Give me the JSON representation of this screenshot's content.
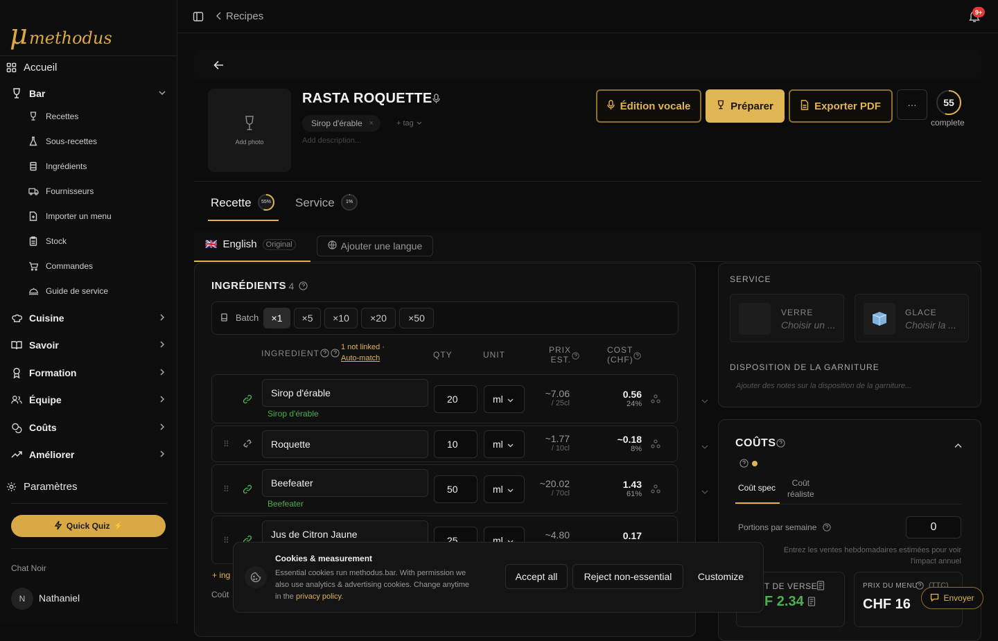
{
  "sidebar": {
    "logo_mu": "μ",
    "logo_name": "methodus",
    "home": "Accueil",
    "bar": "Bar",
    "bar_items": [
      "Recettes",
      "Sous-recettes",
      "Ingrédients",
      "Fournisseurs",
      "Importer un menu",
      "Stock",
      "Commandes",
      "Guide de service"
    ],
    "sections": [
      "Cuisine",
      "Savoir",
      "Formation",
      "Équipe",
      "Coûts",
      "Améliorer"
    ],
    "settings": "Paramètres",
    "quiz": "Quick Quiz",
    "org": "Chat Noir",
    "avatar_initial": "N",
    "user": "Nathaniel"
  },
  "topbar": {
    "breadcrumb": "Recipes",
    "notif_badge": "9+"
  },
  "recipe": {
    "title": "RASTA ROQUETTE",
    "add_photo": "Add photo",
    "tag": "Sirop d'érable",
    "add_tag": "+ tag",
    "description_placeholder": "Add description...",
    "btn_voice": "Édition vocale",
    "btn_prepare": "Préparer",
    "btn_pdf": "Exporter PDF",
    "btn_more": "···",
    "completion": "55",
    "completion_label": "complete"
  },
  "tabs": {
    "recipe": "Recette",
    "recipe_pct": "55%",
    "service": "Service",
    "service_pct": "1%"
  },
  "lang": {
    "current": "English",
    "original": "Original",
    "add": "Ajouter une langue",
    "flag": "🇬🇧"
  },
  "ingredients": {
    "title": "INGRÉDIENTS",
    "count": "· 4",
    "batch_label": "Batch",
    "batch_options": [
      "×1",
      "×5",
      "×10",
      "×20",
      "×50"
    ],
    "col_ingredient": "INGREDIENT",
    "not_linked": "1 not linked ·",
    "auto_match": "Auto-match",
    "col_qty": "QTY",
    "col_unit": "UNIT",
    "col_price1": "PRIX",
    "col_price2": "EST.",
    "col_cost1": "COST",
    "col_cost2": "(CHF)",
    "rows": [
      {
        "name": "Sirop d'érable",
        "linked": "Sirop d'érable",
        "qty": "20",
        "unit": "ml",
        "price": "~7.06",
        "price_sub": "/ 25cl",
        "cost": "0.56",
        "cost_pct": "24%"
      },
      {
        "name": "Roquette",
        "linked": "",
        "qty": "10",
        "unit": "ml",
        "price": "~1.77",
        "price_sub": "/ 10cl",
        "cost": "~0.18",
        "cost_pct": "8%"
      },
      {
        "name": "Beefeater",
        "linked": "Beefeater",
        "qty": "50",
        "unit": "ml",
        "price": "~20.02",
        "price_sub": "/ 70cl",
        "cost": "1.43",
        "cost_pct": "61%"
      },
      {
        "name": "Jus de Citron Jaune",
        "linked": "",
        "qty": "25",
        "unit": "ml",
        "price": "~4.80",
        "price_sub": "",
        "cost": "0.17",
        "cost_pct": ""
      }
    ],
    "add_ing": "+ ing",
    "cost_footer": "Coût"
  },
  "service": {
    "title": "SERVICE",
    "glass_label": "VERRE",
    "glass_value": "Choisir un ...",
    "ice_label": "GLACE",
    "ice_value": "Choisir la ...",
    "garnish_title": "DISPOSITION DE LA GARNITURE",
    "garnish_placeholder": "Ajouter des notes sur la disposition de la garniture..."
  },
  "costs": {
    "title": "COÛTS",
    "tab_spec": "Coût spec",
    "tab_real1": "Coût",
    "tab_real2": "réaliste",
    "portions_label": "Portions par semaine",
    "portions_value": "0",
    "hint1": "Entrez les ventes hebdomadaires estimées pour voir",
    "hint2": "l'impact annuel",
    "pour_label": "T DE VERSE",
    "pour_value": "F 2.34",
    "menu_label": "PRIX DU MENU",
    "menu_ttc": "(TTC)",
    "menu_value": "CHF 16",
    "send": "Envoyer",
    "accent": "#e0b553",
    "green": "#4caf50"
  },
  "cookies": {
    "title": "Cookies & measurement",
    "text1": "Essential cookies run methodus.bar. With permission we",
    "text2": "also use analytics & advertising cookies. Change anytime",
    "text3": "in the",
    "link": "privacy policy.",
    "accept": "Accept all",
    "reject": "Reject non-essential",
    "customize": "Customize"
  }
}
